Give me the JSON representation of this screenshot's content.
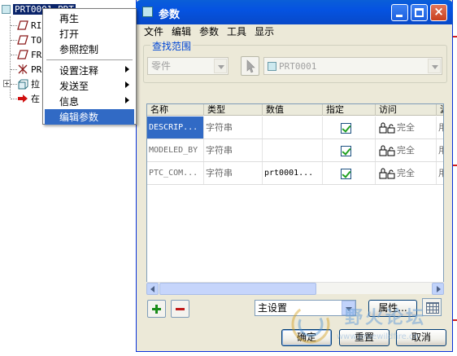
{
  "tree": {
    "root": "PRT0001.PRT",
    "items": [
      "RI",
      "TO",
      "FR",
      "PR",
      "拉",
      "在"
    ]
  },
  "context_menu": {
    "items": [
      {
        "label": "再生",
        "submenu": false
      },
      {
        "label": "打开",
        "submenu": false
      },
      {
        "label": "参照控制",
        "submenu": false
      },
      {
        "label": "设置注释",
        "submenu": true
      },
      {
        "label": "发送至",
        "submenu": true
      },
      {
        "label": "信息",
        "submenu": true
      },
      {
        "label": "编辑参数",
        "submenu": false,
        "selected": true
      }
    ]
  },
  "dialog": {
    "title": "参数",
    "menu": [
      "文件",
      "编辑",
      "参数",
      "工具",
      "显示"
    ],
    "search_scope": {
      "label": "查找范围",
      "type_value": "零件",
      "object_value": "PRT0001"
    },
    "table": {
      "columns": [
        "名称",
        "类型",
        "数值",
        "指定",
        "访问",
        "源"
      ],
      "rows": [
        {
          "name": "DESCRIP...",
          "type": "字符串",
          "value": "",
          "designated": true,
          "access": "完全",
          "source": "用户定义",
          "selected": true
        },
        {
          "name": "MODELED_BY",
          "type": "字符串",
          "value": "",
          "designated": true,
          "access": "完全",
          "source": "用户定义",
          "selected": false
        },
        {
          "name": "PTC_COM...",
          "type": "字符串",
          "value": "prt0001...",
          "designated": true,
          "access": "完全",
          "source": "用户定义",
          "selected": false
        }
      ]
    },
    "settings_combo": "主设置",
    "properties_label": "属性...",
    "ok_label": "确定",
    "reset_label": "重置",
    "cancel_label": "取消"
  },
  "watermark": {
    "text": "野火论坛",
    "url": "www.proewildfire.cn"
  },
  "colors": {
    "title_bar": "#0553e1",
    "selection": "#316ac5",
    "dialog_bg": "#ece9d8"
  }
}
